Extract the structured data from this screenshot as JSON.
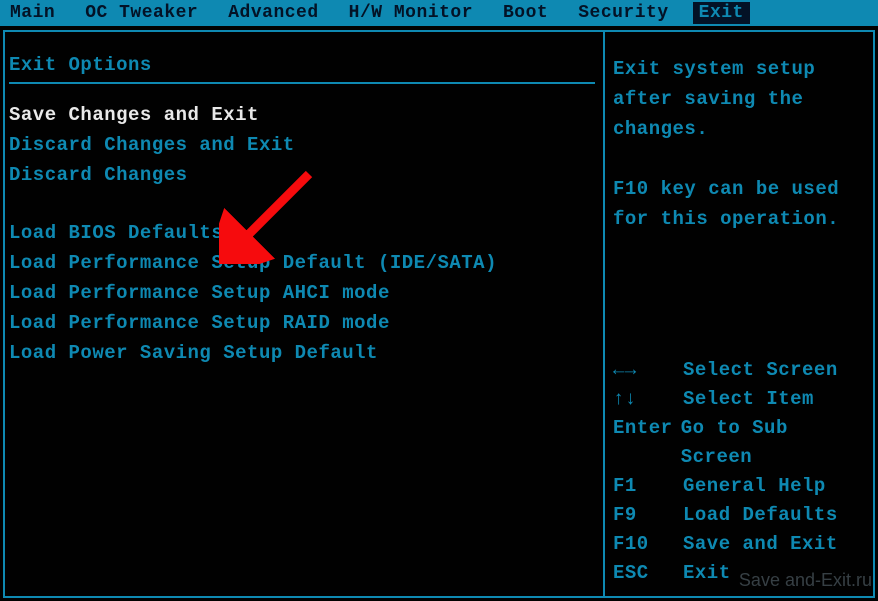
{
  "tabs": {
    "items": [
      "Main",
      "OC Tweaker",
      "Advanced",
      "H/W Monitor",
      "Boot",
      "Security",
      "Exit"
    ],
    "active_index": 6
  },
  "left": {
    "title": "Exit Options",
    "group1": [
      "Save Changes and Exit",
      "Discard Changes and Exit",
      "Discard Changes"
    ],
    "group2": [
      "Load BIOS Defaults",
      "Load Performance Setup Default (IDE/SATA)",
      "Load Performance Setup AHCI mode",
      "Load Performance Setup RAID mode",
      "Load Power Saving Setup Default"
    ],
    "selected": "Save Changes and Exit"
  },
  "right": {
    "help_line1": "Exit system setup",
    "help_line2": "after saving the",
    "help_line3": "changes.",
    "help_line4": "",
    "help_line5": "F10 key can be used",
    "help_line6": "for this operation.",
    "keys": [
      {
        "k": "←→",
        "d": "Select Screen"
      },
      {
        "k": "↑↓",
        "d": "Select Item"
      },
      {
        "k": "Enter",
        "d": "Go to Sub Screen"
      },
      {
        "k": "F1",
        "d": "General Help"
      },
      {
        "k": "F9",
        "d": "Load Defaults"
      },
      {
        "k": "F10",
        "d": "Save and Exit"
      },
      {
        "k": "ESC",
        "d": "Exit"
      }
    ]
  },
  "annotation": {
    "arrow_color": "#f60b0d",
    "watermark": "Save and-Exit.ru"
  }
}
